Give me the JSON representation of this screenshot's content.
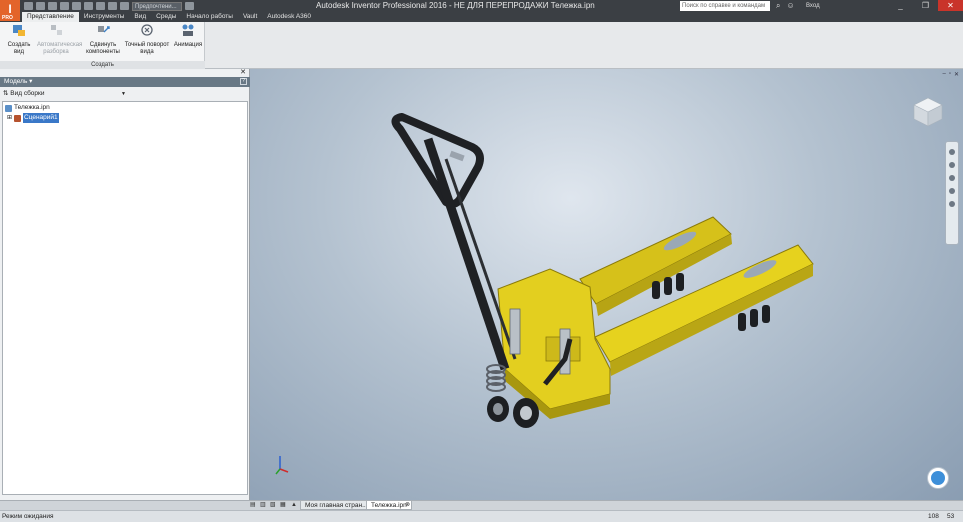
{
  "app": {
    "logo_letter": "I",
    "logo_sub": "PRO",
    "title": "Autodesk Inventor Professional 2016 - НЕ ДЛЯ ПЕРЕПРОДАЖИ   Тележка.ipn",
    "appearance_combo": "Предпочтени...",
    "help_search_placeholder": "Поиск по справке и командам",
    "sign_in": "Вход",
    "win_min": "_",
    "win_max": "❐",
    "win_close": "✕"
  },
  "tabs": [
    "Представление",
    "Инструменты",
    "Вид",
    "Среды",
    "Начало работы",
    "Vault",
    "Autodesk A360"
  ],
  "ribbon": {
    "panel_label": "Создать",
    "buttons": [
      {
        "label": "Создать вид",
        "enabled": true
      },
      {
        "label": "Автоматическая разборка",
        "enabled": false
      },
      {
        "label": "Сдвинуть компоненты",
        "enabled": true
      },
      {
        "label": "Точный поворот вида",
        "enabled": true
      },
      {
        "label": "Анимация",
        "enabled": true
      }
    ]
  },
  "browser": {
    "title": "Модель",
    "view_selector": "Вид сборки",
    "tree": [
      {
        "label": "Тележка.ipn",
        "level": 0
      },
      {
        "label": "Сценарий1",
        "level": 1,
        "selected": true
      }
    ]
  },
  "doc_tabs": [
    {
      "label": "Моя главная стран...",
      "active": false
    },
    {
      "label": "Тележка.ipn",
      "active": true
    }
  ],
  "status": {
    "text": "Режим ожидания",
    "value1": "108",
    "value2": "53"
  },
  "colors": {
    "accent": "#e3642a",
    "fork_yellow": "#e6d21e",
    "handle_black": "#1f2124"
  }
}
